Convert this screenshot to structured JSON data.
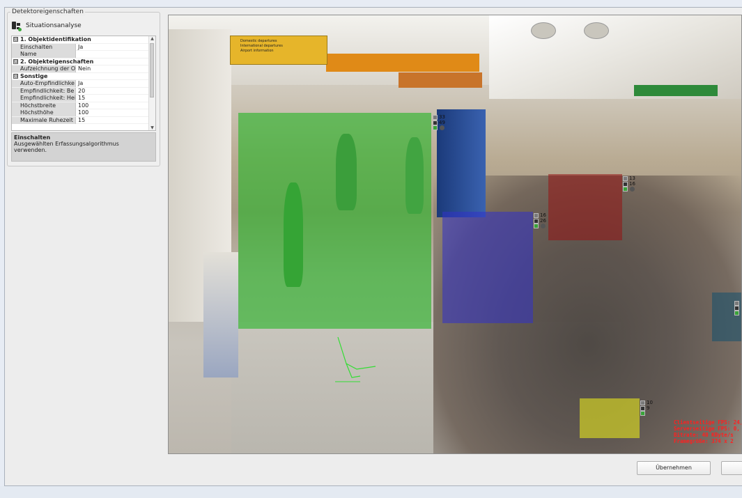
{
  "panel": {
    "group_title": "Detektoreigenschaften",
    "detector_name": "Situationsanalyse",
    "categories": [
      {
        "label": "1. Objektidentifikation",
        "toggle": "⊟",
        "rows": [
          {
            "name": "Einschalten",
            "value": "Ja"
          },
          {
            "name": "Name",
            "value": ""
          }
        ]
      },
      {
        "label": "2. Objekteigenschaften",
        "toggle": "⊟",
        "rows": [
          {
            "name": "Aufzeichnung der O",
            "value": "Nein"
          }
        ]
      },
      {
        "label": "Sonstige",
        "toggle": "⊟",
        "rows": [
          {
            "name": "Auto-Empfindlichke",
            "value": "Ja"
          },
          {
            "name": "Empfindlichkeit: Be",
            "value": "20"
          },
          {
            "name": "Empfindlichkeit: Hei",
            "value": "15"
          },
          {
            "name": "Höchstbreite",
            "value": "100"
          },
          {
            "name": "Höchsthöhe",
            "value": "100"
          },
          {
            "name": "Maximale Ruhezeit",
            "value": "15"
          }
        ]
      }
    ],
    "description_title": "Einschalten",
    "description_text": "Ausgewählten Erfassungsalgorithmus verwenden."
  },
  "video": {
    "sign_lines": [
      "Domestic departures",
      "International departures",
      "Airport information"
    ],
    "detections": [
      {
        "id": "green",
        "color": "#28b428",
        "values": [
          "33",
          "49"
        ]
      },
      {
        "id": "blue",
        "color": "#3232c8",
        "values": [
          "16",
          "26"
        ]
      },
      {
        "id": "red",
        "color": "#961414",
        "values": [
          "13",
          "16"
        ]
      },
      {
        "id": "yellow",
        "color": "#e1e11e",
        "values": [
          "10",
          "9"
        ]
      },
      {
        "id": "teal",
        "color": "#14506e",
        "values": [
          "",
          ""
        ]
      }
    ],
    "stats": [
      "Clientseitige FPS: 24,",
      "Serverseitige FPS: 0,",
      "Bitrate: 40 KByte/s",
      "Framegröße: 374 x 2"
    ]
  },
  "buttons": {
    "apply_label": "Übernehmen",
    "second_label": ""
  }
}
